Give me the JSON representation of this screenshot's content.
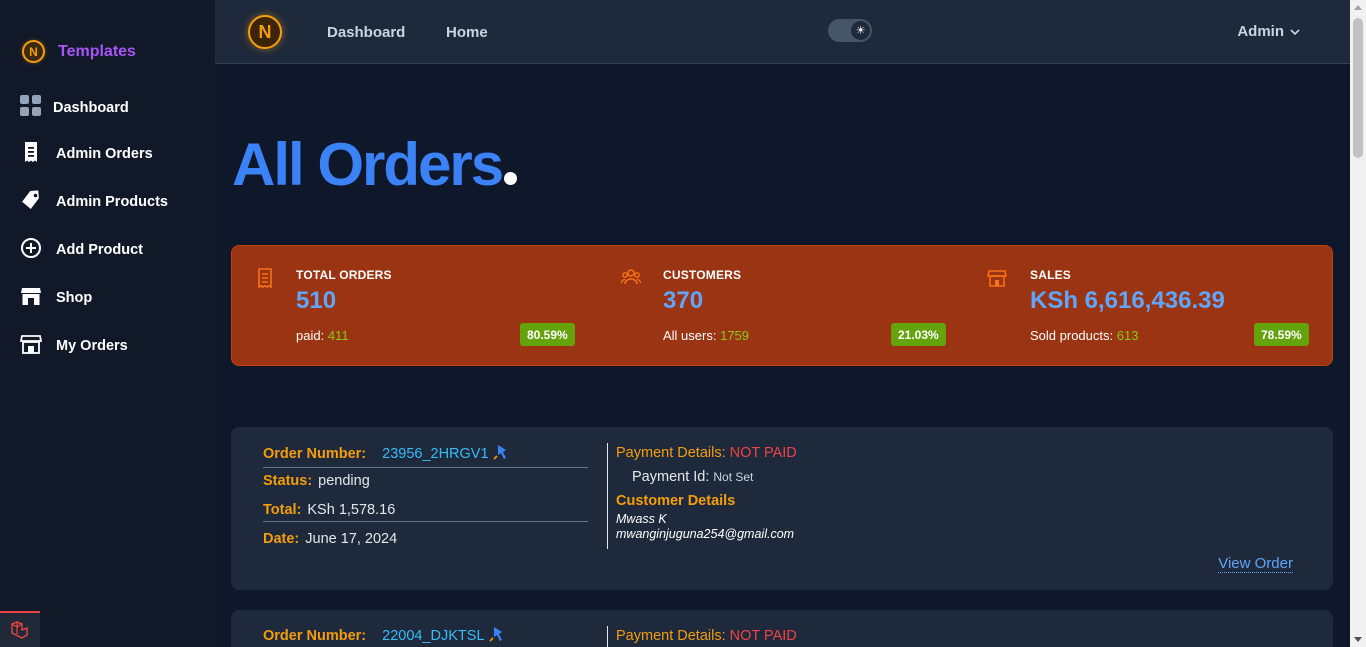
{
  "sidebar": {
    "brand_logo_letter": "N",
    "brand_name": "Templates",
    "items": [
      {
        "label": "Dashboard",
        "icon": "grid-icon"
      },
      {
        "label": "Admin Orders",
        "icon": "receipt-icon"
      },
      {
        "label": "Admin Products",
        "icon": "tag-icon"
      },
      {
        "label": "Add Product",
        "icon": "plus-circle-icon"
      },
      {
        "label": "Shop",
        "icon": "store-icon"
      },
      {
        "label": "My Orders",
        "icon": "store-icon"
      }
    ]
  },
  "topbar": {
    "logo_letter": "N",
    "links": [
      "Dashboard",
      "Home"
    ],
    "theme_toggle_icon": "sun-icon",
    "user_menu": "Admin"
  },
  "page": {
    "title": "All Orders"
  },
  "stats": {
    "total_orders": {
      "label": "TOTAL ORDERS",
      "value": "510",
      "sub_label": "paid:",
      "sub_value": "411",
      "badge": "80.59%"
    },
    "customers": {
      "label": "CUSTOMERS",
      "value": "370",
      "sub_label": "All users:",
      "sub_value": "1759",
      "badge": "21.03%"
    },
    "sales": {
      "label": "SALES",
      "value": "KSh 6,616,436.39",
      "sub_label": "Sold products:",
      "sub_value": "613",
      "badge": "78.59%"
    }
  },
  "orders": [
    {
      "number_label": "Order Number:",
      "number": "23956_2HRGV1",
      "status_label": "Status:",
      "status": "pending",
      "total_label": "Total:",
      "total": "KSh 1,578.16",
      "date_label": "Date:",
      "date": "June 17, 2024",
      "payment_label": "Payment Details:",
      "payment_status": "NOT PAID",
      "payment_id_label": "Payment Id:",
      "payment_id": "Not Set",
      "customer_heading": "Customer Details",
      "customer_name": "Mwass K",
      "customer_email": "mwanginjuguna254@gmail.com",
      "view_link": "View Order"
    },
    {
      "number_label": "Order Number:",
      "number": "22004_DJKTSL",
      "payment_label": "Payment Details:",
      "payment_status": "NOT PAID"
    }
  ],
  "colors": {
    "accent_blue": "#3b82f6",
    "stats_bg": "#9a3412",
    "label_orange": "#f59e0b",
    "danger": "#ef4444",
    "success_badge": "#65a30d"
  }
}
